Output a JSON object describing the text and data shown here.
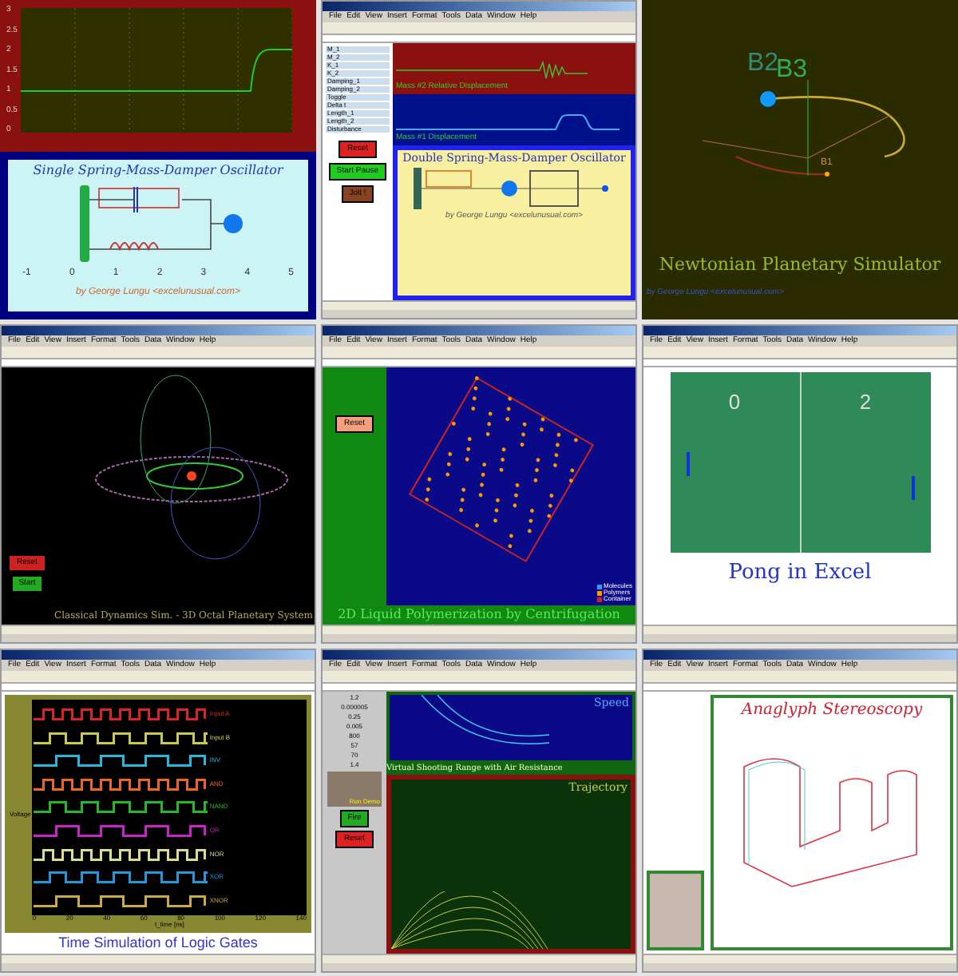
{
  "tiles": [
    {
      "kind": "spring",
      "y_ticks": [
        "3",
        "2.5",
        "2",
        "1.5",
        "1",
        "0.5",
        "0"
      ],
      "title": "Single Spring-Mass-Damper Oscillator",
      "axis_labels": [
        "-1",
        "0",
        "1",
        "2",
        "3",
        "4",
        "5"
      ],
      "credit": "by George Lungu <excelunusual.com>"
    },
    {
      "kind": "double_spring",
      "menu": [
        "File",
        "Edit",
        "View",
        "Insert",
        "Format",
        "Tools",
        "Data",
        "Window",
        "Help"
      ],
      "params": [
        "M_1",
        "M_2",
        "K_1",
        "K_2",
        "Damping_1",
        "Damping_2",
        "Toggle",
        "Delta t",
        "Length_1",
        "Length_2",
        "Disturbance"
      ],
      "chart_labels": [
        "Mass #2 Relative Displacement",
        "Mass #1 Displacement"
      ],
      "title": "Double Spring-Mass-Damper Oscillator",
      "credit": "by George Lungu <excelunusual.com>",
      "buttons": [
        {
          "label": "Reset",
          "color": "#dd2222"
        },
        {
          "label": "Start Pause",
          "color": "#22cc22"
        },
        {
          "label": "Jolt !",
          "color": "#884422"
        }
      ]
    },
    {
      "kind": "planetary",
      "labels": [
        "B2",
        "B3",
        "B1"
      ],
      "title": "Newtonian Planetary Simulator",
      "credit": "by George Lungu <excelunusual.com>"
    },
    {
      "kind": "octal",
      "menu": [
        "File",
        "Edit",
        "View",
        "Insert",
        "Format",
        "Tools",
        "Data",
        "Window",
        "Help"
      ],
      "title": "Classical Dynamics Sim. - 3D Octal Planetary System",
      "buttons": [
        {
          "label": "Reset",
          "color": "#cc2222"
        },
        {
          "label": "Start",
          "color": "#22aa22"
        }
      ]
    },
    {
      "kind": "polymer",
      "menu": [
        "File",
        "Edit",
        "View",
        "Insert",
        "Format",
        "Tools",
        "Data",
        "Window",
        "Help"
      ],
      "buttons": [
        {
          "label": "Reset",
          "color": "#f4a080"
        }
      ],
      "legend": [
        {
          "label": "Molecules",
          "color": "#3399ff"
        },
        {
          "label": "Polymers",
          "color": "#ff9900"
        },
        {
          "label": "Container",
          "color": "#cc2222"
        }
      ],
      "title": "2D Liquid Polymerization by Centrifugation"
    },
    {
      "kind": "pong",
      "menu": [
        "File",
        "Edit",
        "View",
        "Insert",
        "Format",
        "Tools",
        "Data",
        "Window",
        "Help"
      ],
      "scores": [
        "0",
        "2"
      ],
      "title": "Pong in Excel"
    },
    {
      "kind": "logic",
      "menu": [
        "File",
        "Edit",
        "View",
        "Insert",
        "Format",
        "Tools",
        "Data",
        "Window",
        "Help"
      ],
      "signals": [
        {
          "label": "Input A",
          "color": "#dd2222"
        },
        {
          "label": "Input B",
          "color": "#cccc44"
        },
        {
          "label": "INV",
          "color": "#22bbdd"
        },
        {
          "label": "AND",
          "color": "#ee6622"
        },
        {
          "label": "NAND",
          "color": "#22bb22"
        },
        {
          "label": "OR",
          "color": "#cc22cc"
        },
        {
          "label": "NOR",
          "color": "#dddd88"
        },
        {
          "label": "XOR",
          "color": "#2299dd"
        },
        {
          "label": "XNOR",
          "color": "#ccaa44"
        }
      ],
      "xticks": [
        "0",
        "20",
        "40",
        "60",
        "80",
        "100",
        "120",
        "140"
      ],
      "ylabel": "Voltage",
      "xlabel": "t_time [ns]",
      "title": "Time Simulation of Logic Gates"
    },
    {
      "kind": "shooting",
      "menu": [
        "File",
        "Edit",
        "View",
        "Insert",
        "Format",
        "Tools",
        "Data",
        "Window",
        "Help"
      ],
      "values": [
        "1.2",
        "0.000005",
        "0.25",
        "0.005",
        "800",
        "57",
        "70",
        "1.4"
      ],
      "speed_label": "Speed",
      "trajectory_label": "Trajectory",
      "title": "Virtual Shooting Range with Air Resistance",
      "demo_label": "Run Demo",
      "buttons": [
        {
          "label": "Fire",
          "color": "#22aa22"
        },
        {
          "label": "Reset",
          "color": "#dd2222"
        }
      ]
    },
    {
      "kind": "anaglyph",
      "menu": [
        "File",
        "Edit",
        "View",
        "Insert",
        "Format",
        "Tools",
        "Data",
        "Window",
        "Help"
      ],
      "title": "Anaglyph Stereoscopy"
    }
  ]
}
